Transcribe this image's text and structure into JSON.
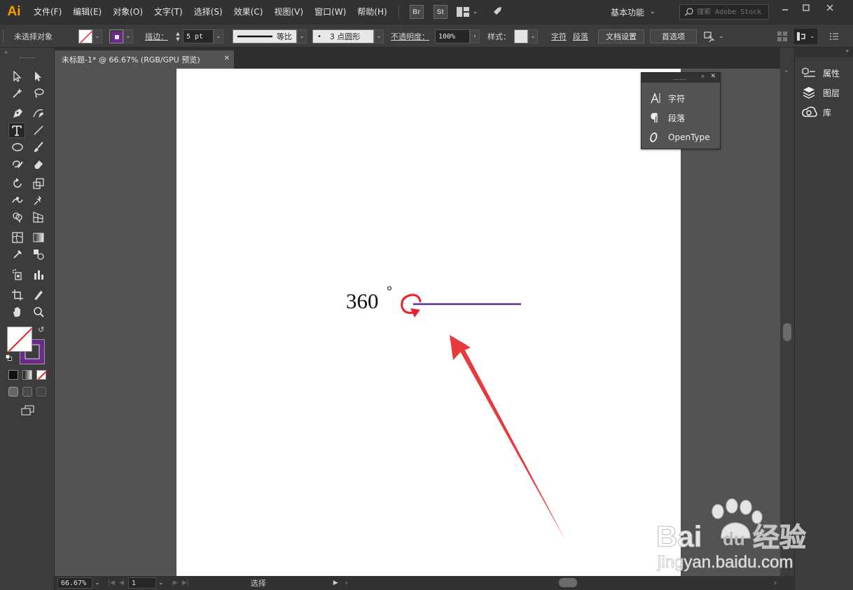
{
  "app": {
    "logo_text": "Ai",
    "accent": "#ff9a00"
  },
  "menu": {
    "items": [
      "文件(F)",
      "编辑(E)",
      "对象(O)",
      "文字(T)",
      "选择(S)",
      "效果(C)",
      "视图(V)",
      "窗口(W)",
      "帮助(H)"
    ],
    "bridge_labels": [
      "Br",
      "St"
    ]
  },
  "workspace": {
    "label": "基本功能",
    "search_placeholder": "搜索 Adobe Stock"
  },
  "control_bar": {
    "selection_label": "未选择对象",
    "stroke_label": "描边：",
    "stroke_weight": "5 pt",
    "profile_label": "等比",
    "brush_label": "3 点圆形",
    "brush_dot": "•",
    "opacity_label": "不透明度：",
    "opacity_value": "100%",
    "style_label": "样式：",
    "char_label": "字符",
    "para_label": "段落",
    "doc_setup_label": "文档设置",
    "prefs_label": "首选项",
    "stroke_color": "#6a2a8c"
  },
  "document": {
    "tab_title": "未标题-1* @ 66.67% (RGB/GPU 预览)",
    "close_symbol": "✕"
  },
  "artwork": {
    "text": "360",
    "degree": "°",
    "line_color": "#5b2d8e",
    "arrow_color": "#e8393c",
    "spiral_color": "#e8212b"
  },
  "type_panel": {
    "rows": [
      {
        "label": "字符"
      },
      {
        "label": "段落"
      },
      {
        "label": "OpenType"
      }
    ]
  },
  "right_dock": {
    "rows": [
      {
        "label": "属性"
      },
      {
        "label": "图层"
      },
      {
        "label": "库"
      }
    ]
  },
  "status_bar": {
    "zoom": "66.67%",
    "page": "1",
    "status_text": "选择"
  },
  "watermark": {
    "brand_text": "Bai",
    "brand_text2": "du",
    "product_text": "经验",
    "url_text": "jingyan.baidu.com"
  }
}
